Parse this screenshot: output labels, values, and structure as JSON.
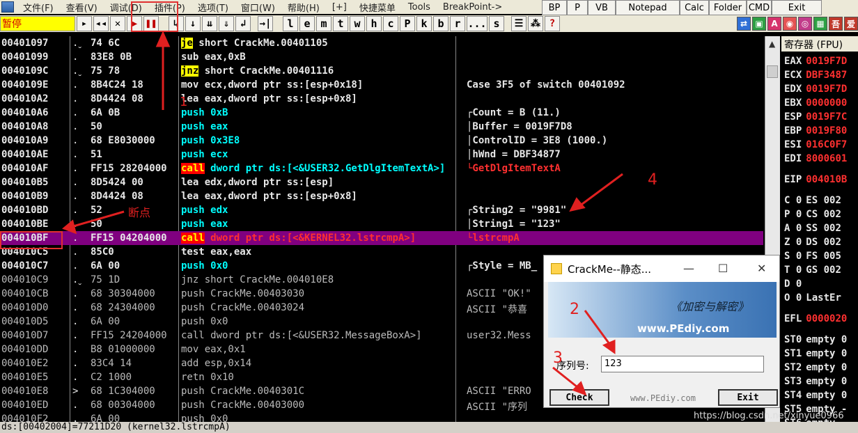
{
  "menubar": {
    "items": [
      "文件(F)",
      "查看(V)",
      "调试(D)",
      "插件(P)",
      "选项(T)",
      "窗口(W)",
      "帮助(H)",
      "[+]",
      "快捷菜单",
      "Tools",
      "BreakPoint->"
    ]
  },
  "buttonbar": {
    "buttons": [
      "BP",
      "P",
      "VB",
      "Notepad",
      "Calc",
      "Folder",
      "CMD",
      "Exit"
    ]
  },
  "toolbar": {
    "status": "暂停",
    "buttons": [
      "▸",
      "◂◂",
      "✕",
      "▶",
      "❚❚",
      "↳",
      "↓",
      "⇊",
      "⇓",
      "↲",
      "→|"
    ],
    "letters": [
      "l",
      "e",
      "m",
      "t",
      "w",
      "h",
      "c",
      "P",
      "k",
      "b",
      "r",
      "...",
      "s"
    ],
    "extra": [
      "☰",
      "⁂",
      "?"
    ],
    "colored": [
      "⇄",
      "▣",
      "A",
      "◉",
      "◎",
      "▦",
      "吾",
      "爱"
    ]
  },
  "disasm": {
    "rows": [
      {
        "addr": "00401097",
        "mark": ".ˬ",
        "hex": "74 6C",
        "asm_kw": "je",
        "asm_rest": " short CrackMe.00401105",
        "kw": "y",
        "cmt": ""
      },
      {
        "addr": "00401099",
        "mark": ".",
        "hex": "83E8 0B",
        "asm_kw": "",
        "asm_rest": "sub eax,0xB",
        "kw": "",
        "cmt": ""
      },
      {
        "addr": "0040109C",
        "mark": ".ˬ",
        "hex": "75 78",
        "asm_kw": "jnz",
        "asm_rest": " short CrackMe.00401116",
        "kw": "y",
        "cmt": ""
      },
      {
        "addr": "0040109E",
        "mark": ".",
        "hex": "8B4C24 18",
        "asm_kw": "",
        "asm_rest": "mov ecx,dword ptr ss:[esp+0x18]",
        "kw": "",
        "cmt": "Case 3F5 of switch 00401092"
      },
      {
        "addr": "004010A2",
        "mark": ".",
        "hex": "8D4424 08",
        "asm_kw": "",
        "asm_rest": "lea eax,dword ptr ss:[esp+0x8]",
        "kw": "",
        "cmt": ""
      },
      {
        "addr": "004010A6",
        "mark": ".",
        "hex": "6A 0B",
        "asm_kw": "",
        "asm_rest": "push 0xB",
        "kw": "",
        "cmt": "┌Count = B (11.)",
        "cyan": true
      },
      {
        "addr": "004010A8",
        "mark": ".",
        "hex": "50",
        "asm_kw": "",
        "asm_rest": "push eax",
        "kw": "",
        "cmt": "│Buffer = 0019F7D8",
        "cyan": true
      },
      {
        "addr": "004010A9",
        "mark": ".",
        "hex": "68 E8030000",
        "asm_kw": "",
        "asm_rest": "push 0x3E8",
        "kw": "",
        "cmt": "│ControlID = 3E8 (1000.)",
        "cyan": true
      },
      {
        "addr": "004010AE",
        "mark": ".",
        "hex": "51",
        "asm_kw": "",
        "asm_rest": "push ecx",
        "kw": "",
        "cmt": "│hWnd = DBF34877",
        "cyan": true
      },
      {
        "addr": "004010AF",
        "mark": ".",
        "hex": "FF15 28204000",
        "asm_kw": "call",
        "asm_rest": " dword ptr ds:[<&USER32.GetDlgItemTextA>]",
        "kw": "r",
        "cmt": "└GetDlgItemTextA",
        "cmtred": true
      },
      {
        "addr": "004010B5",
        "mark": ".",
        "hex": "8D5424 00",
        "asm_kw": "",
        "asm_rest": "lea edx,dword ptr ss:[esp]",
        "kw": "",
        "cmt": ""
      },
      {
        "addr": "004010B9",
        "mark": ".",
        "hex": "8D4424 08",
        "asm_kw": "",
        "asm_rest": "lea eax,dword ptr ss:[esp+0x8]",
        "kw": "",
        "cmt": ""
      },
      {
        "addr": "004010BD",
        "mark": ".",
        "hex": "52",
        "asm_kw": "",
        "asm_rest": "push edx",
        "kw": "",
        "cmt": "┌String2 = \"9981\"",
        "cyan": true
      },
      {
        "addr": "004010BE",
        "mark": ".",
        "hex": "50",
        "asm_kw": "",
        "asm_rest": "push eax",
        "kw": "",
        "cmt": "│String1 = \"123\"",
        "cyan": true
      },
      {
        "addr": "004010BF",
        "mark": ".",
        "hex": "FF15 04204000",
        "asm_kw": "call",
        "asm_rest": " dword ptr ds:[<&KERNEL32.lstrcmpA>]",
        "kw": "r",
        "cmt": "└lstrcmpA",
        "sel": true,
        "cmtred": true
      },
      {
        "addr": "004010C5",
        "mark": ".",
        "hex": "85C0",
        "asm_kw": "",
        "asm_rest": "test eax,eax",
        "kw": "",
        "cmt": ""
      },
      {
        "addr": "004010C7",
        "mark": ".",
        "hex": "6A 00",
        "asm_kw": "",
        "asm_rest": "push 0x0",
        "kw": "",
        "cmt": "┌Style = MB_",
        "cyan": true
      },
      {
        "addr": "004010C9",
        "mark": ".ˬ",
        "hex": "75 1D",
        "asm_kw": "",
        "asm_rest": "jnz short CrackMe.004010E8",
        "kw": "",
        "cmt": "",
        "dim": true
      },
      {
        "addr": "004010CB",
        "mark": ".",
        "hex": "68 30304000",
        "asm_kw": "",
        "asm_rest": "push CrackMe.00403030",
        "kw": "",
        "cmt": "ASCII \"OK!\"",
        "dim": true
      },
      {
        "addr": "004010D0",
        "mark": ".",
        "hex": "68 24304000",
        "asm_kw": "",
        "asm_rest": "push CrackMe.00403024",
        "kw": "",
        "cmt": "ASCII \"恭喜",
        "dim": true
      },
      {
        "addr": "004010D5",
        "mark": ".",
        "hex": "6A 00",
        "asm_kw": "",
        "asm_rest": "push 0x0",
        "kw": "",
        "cmt": "",
        "dim": true
      },
      {
        "addr": "004010D7",
        "mark": ".",
        "hex": "FF15 24204000",
        "asm_kw": "",
        "asm_rest": "call dword ptr ds:[<&USER32.MessageBoxA>]",
        "kw": "",
        "cmt": "user32.Mess",
        "dim": true
      },
      {
        "addr": "004010DD",
        "mark": ".",
        "hex": "B8 01000000",
        "asm_kw": "",
        "asm_rest": "mov eax,0x1",
        "kw": "",
        "cmt": "",
        "dim": true
      },
      {
        "addr": "004010E2",
        "mark": ".",
        "hex": "83C4 14",
        "asm_kw": "",
        "asm_rest": "add esp,0x14",
        "kw": "",
        "cmt": "",
        "dim": true
      },
      {
        "addr": "004010E5",
        "mark": ".",
        "hex": "C2 1000",
        "asm_kw": "",
        "asm_rest": "retn 0x10",
        "kw": "",
        "cmt": "",
        "dim": true
      },
      {
        "addr": "004010E8",
        "mark": ">",
        "hex": "68 1C304000",
        "asm_kw": "",
        "asm_rest": "push CrackMe.0040301C",
        "kw": "",
        "cmt": "ASCII \"ERRO",
        "dim": true
      },
      {
        "addr": "004010ED",
        "mark": ".",
        "hex": "68 00304000",
        "asm_kw": "",
        "asm_rest": "push CrackMe.00403000",
        "kw": "",
        "cmt": "ASCII \"序列",
        "dim": true
      },
      {
        "addr": "004010F2",
        "mark": ".",
        "hex": "6A 00",
        "asm_kw": "",
        "asm_rest": "push 0x0",
        "kw": "",
        "cmt": "",
        "dim": true
      }
    ]
  },
  "statusline": "ds:[00402004]=77211D20 (kernel32.lstrcmpA)",
  "registers": {
    "header": "寄存器 (FPU)",
    "items": [
      {
        "name": "EAX",
        "val": "0019F7D"
      },
      {
        "name": "ECX",
        "val": "DBF3487"
      },
      {
        "name": "EDX",
        "val": "0019F7D"
      },
      {
        "name": "EBX",
        "val": "0000000"
      },
      {
        "name": "ESP",
        "val": "0019F7C"
      },
      {
        "name": "EBP",
        "val": "0019F80"
      },
      {
        "name": "ESI",
        "val": "016C0F7"
      },
      {
        "name": "EDI",
        "val": "8000601"
      },
      {
        "name": "EIP",
        "val": "004010B"
      },
      {
        "name": "C 0",
        "val": "ES 002"
      },
      {
        "name": "P 0",
        "val": "CS 002"
      },
      {
        "name": "A 0",
        "val": "SS 002"
      },
      {
        "name": "Z 0",
        "val": "DS 002"
      },
      {
        "name": "S 0",
        "val": "FS 005"
      },
      {
        "name": "T 0",
        "val": "GS 002"
      },
      {
        "name": "D 0",
        "val": ""
      },
      {
        "name": "O 0",
        "val": "LastEr"
      },
      {
        "name": "EFL",
        "val": "0000020"
      },
      {
        "name": "ST0",
        "val": "empty 0"
      },
      {
        "name": "ST1",
        "val": "empty 0"
      },
      {
        "name": "ST2",
        "val": "empty 0"
      },
      {
        "name": "ST3",
        "val": "empty 0"
      },
      {
        "name": "ST4",
        "val": "empty 0"
      },
      {
        "name": "ST5",
        "val": "empty -"
      },
      {
        "name": "ST6",
        "val": "empty"
      }
    ]
  },
  "dialog": {
    "title": "CrackMe--静态...",
    "banner_title": "《加密与解密》",
    "banner_site": "www.PEdiy.com",
    "serial_label": "序列号:",
    "serial_value": "123",
    "check_label": "Check",
    "exit_label": "Exit",
    "footer_site": "www.PEdiy.com"
  },
  "annotations": {
    "breakpoint_label": "断点",
    "n1": "1",
    "n2": "2",
    "n3": "3",
    "n4": "4"
  },
  "watermark": "https://blog.csdn.net/xinyue0966"
}
